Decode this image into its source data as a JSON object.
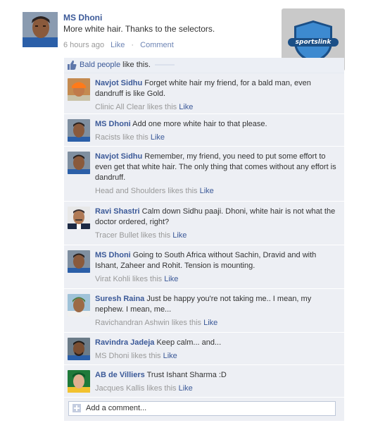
{
  "post": {
    "author": "MS Dhoni",
    "text": "More white hair. Thanks to the selectors.",
    "time": "6 hours ago",
    "like": "Like",
    "separator": "·",
    "comment": "Comment"
  },
  "logo": {
    "text": "sportslink"
  },
  "likes_row": {
    "who": "Bald people",
    "suffix": "like this."
  },
  "comments": [
    {
      "author": "Navjot Sidhu",
      "text": "Forget white hair my friend, for a bald man, even dandruff is like Gold.",
      "likes": "Clinic All Clear likes this",
      "like": "Like"
    },
    {
      "author": "MS Dhoni",
      "text": "Add one more white hair to that please.",
      "likes": "Racists like this",
      "like": "Like"
    },
    {
      "author": "Navjot Sidhu",
      "text": "Remember, my friend, you need to put some effort to even get that white hair. The only thing that comes without any effort is dandruff.",
      "likes": "Head and Shoulders likes this",
      "like": "Like"
    },
    {
      "author": "Ravi Shastri",
      "text": "Calm down Sidhu paaji. Dhoni, white hair is not what the doctor ordered, right?",
      "likes": "Tracer Bullet likes this",
      "like": "Like"
    },
    {
      "author": "MS Dhoni",
      "text": "Going to South Africa without Sachin, Dravid and with Ishant, Zaheer and Rohit. Tension is mounting.",
      "likes": "Virat Kohli likes this",
      "like": "Like"
    },
    {
      "author": "Suresh Raina",
      "text": "Just be happy you're not taking me.. I mean, my nephew. I mean, me...",
      "likes": "Ravichandran Ashwin likes this",
      "like": "Like"
    },
    {
      "author": "Ravindra Jadeja",
      "text": "Keep calm... and...",
      "likes": "MS Dhoni likes this",
      "like": "Like"
    },
    {
      "author": "AB de Villiers",
      "text": "Trust Ishant Sharma :D",
      "likes": "Jacques Kallis likes this",
      "like": "Like"
    }
  ],
  "add_comment": {
    "placeholder": "Add a comment..."
  },
  "colors": {
    "link": "#3b5998",
    "thread_bg": "#edeff4",
    "muted": "#999999"
  }
}
